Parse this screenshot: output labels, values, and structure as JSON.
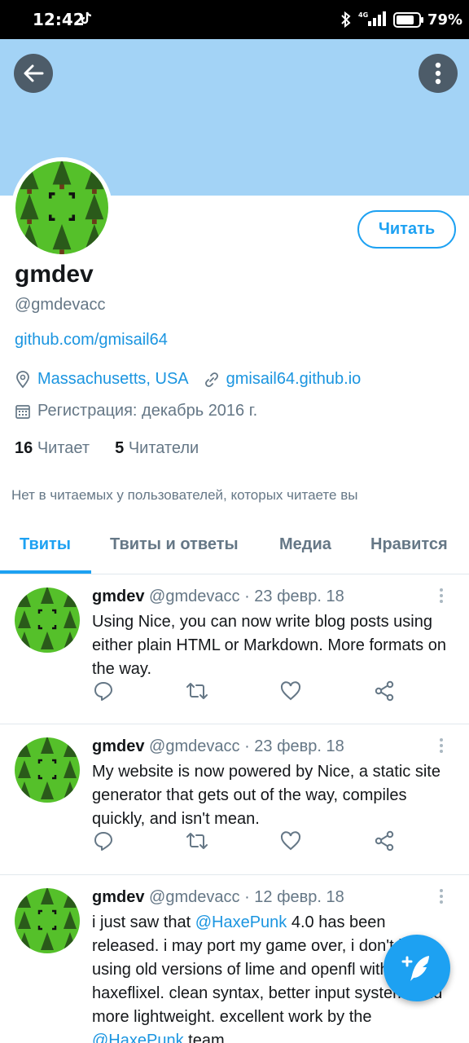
{
  "status_bar": {
    "time": "12:42",
    "network": "4G",
    "battery": "79%"
  },
  "profile": {
    "name": "gmdev",
    "handle": "@gmdevacc",
    "bio_link": "github.com/gmisail64",
    "location": "Massachusetts, USA",
    "website": "gmisail64.github.io",
    "joined": "Регистрация: декабрь 2016 г.",
    "following_count": "16",
    "following_label": "Читает",
    "followers_count": "5",
    "followers_label": "Читатели",
    "follow_button": "Читать",
    "mutual_note": "Нет в читаемых у пользователей, которых читаете вы"
  },
  "tabs": [
    {
      "label": "Твиты",
      "active": true
    },
    {
      "label": "Твиты и ответы",
      "active": false
    },
    {
      "label": "Медиа",
      "active": false
    },
    {
      "label": "Нравится",
      "active": false
    }
  ],
  "tweets": [
    {
      "name": "gmdev",
      "handle": "@gmdevacc",
      "date": "· 23 февр. 18",
      "text": "Using Nice, you can now write blog posts using either plain HTML or Markdown. More formats on the way."
    },
    {
      "name": "gmdev",
      "handle": "@gmdevacc",
      "date": "· 23 февр. 18",
      "text": "My website is now powered by Nice, a static site generator that gets out of the way, compiles quickly, and isn't mean."
    },
    {
      "name": "gmdev",
      "handle": "@gmdevacc",
      "date": "· 12 февр. 18",
      "text_before": "i just saw that ",
      "mention": "@HaxePunk",
      "text_after": " 4.0 has been released. i may port my game over, i don't love using old versions of lime and openfl with haxeflixel. clean syntax, better input system, and more lightweight. excellent work by the ",
      "mention2": "@HaxePunk",
      "text_after2": " team."
    }
  ],
  "colors": {
    "accent": "#1da1f2",
    "banner": "#a3d3f6",
    "muted": "#657786"
  },
  "icons": [
    "back-arrow-icon",
    "more-vertical-icon",
    "location-icon",
    "link-icon",
    "calendar-icon",
    "reply-icon",
    "retweet-icon",
    "like-icon",
    "share-icon",
    "compose-tweet-icon"
  ]
}
